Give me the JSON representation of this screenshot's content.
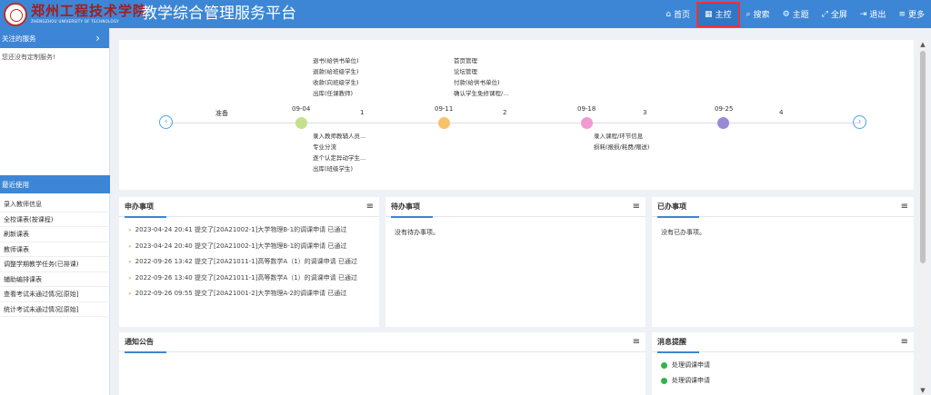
{
  "header": {
    "logo_cn": "郑州工程技术学院",
    "logo_en": "ZHENGZHOU UNIVERSITY OF TECHNOLOGY",
    "app_title": "教学综合管理服务平台",
    "nav": [
      {
        "label": "首页",
        "icon": "home-icon",
        "glyph": "⌂"
      },
      {
        "label": "主控",
        "icon": "windows-icon",
        "glyph": "▦"
      },
      {
        "label": "搜索",
        "icon": "search-icon",
        "glyph": "⌕"
      },
      {
        "label": "主题",
        "icon": "gears-icon",
        "glyph": "⚙"
      },
      {
        "label": "全屏",
        "icon": "fullscreen-icon",
        "glyph": "⤢"
      },
      {
        "label": "退出",
        "icon": "logout-icon",
        "glyph": "⇥"
      },
      {
        "label": "更多",
        "icon": "menu-icon",
        "glyph": "≡"
      }
    ],
    "accent": "#3d86d6",
    "active_border": "#ee3333"
  },
  "sidebar": {
    "fav_title": "关注的服务",
    "fav_empty": "您还没有定制服务!",
    "recent_title": "最近使用",
    "recent_items": [
      "录入教师信息",
      "全校课表(按课程)",
      "刷新课表",
      "教师课表",
      "调整学期教学任务(已排课)",
      "辅助编排课表",
      "查看考试未通过情况[原始]",
      "统计考试未通过情况[原始]"
    ]
  },
  "timeline": {
    "start_label": "准备",
    "dates": [
      "09-04",
      "09-11",
      "09-18",
      "09-25"
    ],
    "weeks": [
      "1",
      "2",
      "3",
      "4"
    ],
    "dot_colors": [
      "#c5e08a",
      "#f6c36a",
      "#f19ad0",
      "#9a8ad6"
    ],
    "above_w1": [
      "退书(给供书单位)",
      "退款(给班级学生)",
      "收款(向班级学生)",
      "出库(任课教师)"
    ],
    "above_w2": [
      "首页管理",
      "论坛管理",
      "付款(给供书单位)",
      "确认学生免修课程/..."
    ],
    "below_w1": [
      "录入教师教辅人员...",
      "专业分流",
      "逐个认定异动学生...",
      "出库(班级学生)"
    ],
    "below_w3": [
      "录入课程/环节信息",
      "损耗(报损/耗费/赠送)"
    ]
  },
  "cards": {
    "apply": {
      "title": "申办事项",
      "items": [
        "2023-04-24 20:41 提交了[20A21002-1]大学物理B-1的调课申请 已通过",
        "2023-04-24 20:40 提交了[20A21002-1]大学物理B-1的调课申请 已通过",
        "2022-09-26 13:42 提交了[20A21011-1]高等数学A（1）的调课申请 已通过",
        "2022-09-26 13:40 提交了[20A21011-1]高等数学A（1）的调课申请 已通过",
        "2022-09-26 09:55 提交了[20A21001-2]大学物理A-2的调课申请 已通过"
      ]
    },
    "todo": {
      "title": "待办事项",
      "empty": "没有待办事项。"
    },
    "done": {
      "title": "已办事项",
      "empty": "没有已办事项。"
    },
    "notice": {
      "title": "通知公告"
    },
    "message": {
      "title": "消息提醒",
      "items": [
        "处理调课申请",
        "处理调课申请"
      ]
    }
  }
}
